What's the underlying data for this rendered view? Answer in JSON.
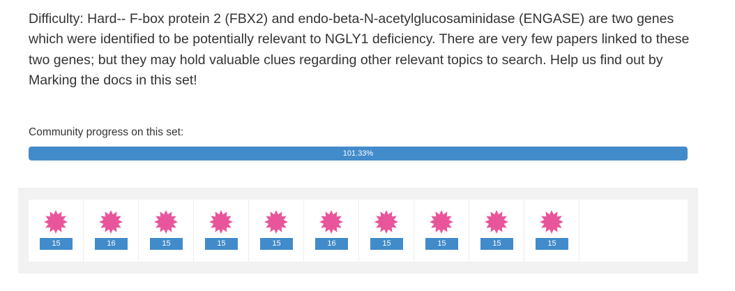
{
  "task": {
    "description": "Difficulty: Hard-- F-box protein 2 (FBX2) and endo-beta-N-acetylglucosaminidase (ENGASE) are two genes which were identified to be potentially relevant to NGLY1 deficiency. There are very few papers linked to these two genes; but they may hold valuable clues regarding other relevant topics to search. Help us find out by Marking the docs in this set!"
  },
  "progress": {
    "label": "Community progress on this set:",
    "percent": 101.33,
    "percent_text": "101.33%"
  },
  "documents": [
    {
      "badge": "15",
      "icon": "pink-starburst-icon"
    },
    {
      "badge": "16",
      "icon": "pink-starburst-icon"
    },
    {
      "badge": "15",
      "icon": "pink-starburst-icon"
    },
    {
      "badge": "15",
      "icon": "pink-starburst-icon"
    },
    {
      "badge": "15",
      "icon": "pink-starburst-icon"
    },
    {
      "badge": "16",
      "icon": "pink-starburst-icon"
    },
    {
      "badge": "15",
      "icon": "pink-starburst-icon"
    },
    {
      "badge": "15",
      "icon": "pink-starburst-icon"
    },
    {
      "badge": "15",
      "icon": "pink-starburst-icon"
    },
    {
      "badge": "15",
      "icon": "pink-starburst-icon"
    }
  ],
  "colors": {
    "progress_fill": "#428bca",
    "badge": "#428bca",
    "star": "#e8559a",
    "panel_bg": "#f2f2f2"
  }
}
